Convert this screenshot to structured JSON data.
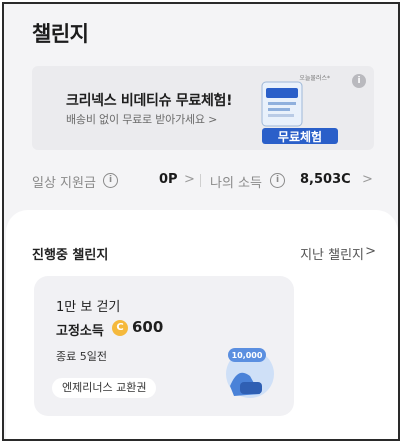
{
  "header": {
    "title": "챌린지"
  },
  "banner": {
    "title": "크리넥스 비데티슈 무료체험!",
    "subtitle": "배송비 없이 무료로 받아가세요 >",
    "brand": "오늘물러스*",
    "product_label": "무료체험",
    "info_glyph": "i"
  },
  "points": {
    "daily_label": "일상 지원금",
    "daily_value": "0P",
    "income_label": "나의 소득",
    "income_value": "8,503C",
    "info_glyph": "i",
    "chevron": ">"
  },
  "challenges": {
    "section_title": "진행중 챌린지",
    "past_link": "지난 챌린지",
    "chevron": ">",
    "cards": [
      {
        "name": "1만 보 걷기",
        "reward_label": "고정소득",
        "coin_glyph": "C",
        "reward_amount": "600",
        "ends": "종료 5일전",
        "tag": "엔제리너스 교환권",
        "badge": "10,000"
      }
    ]
  },
  "colors": {
    "accent_coin": "#f5b93c",
    "product_blue": "#2a5fc9",
    "background": "#f4f4f6",
    "panel": "#ffffff"
  }
}
